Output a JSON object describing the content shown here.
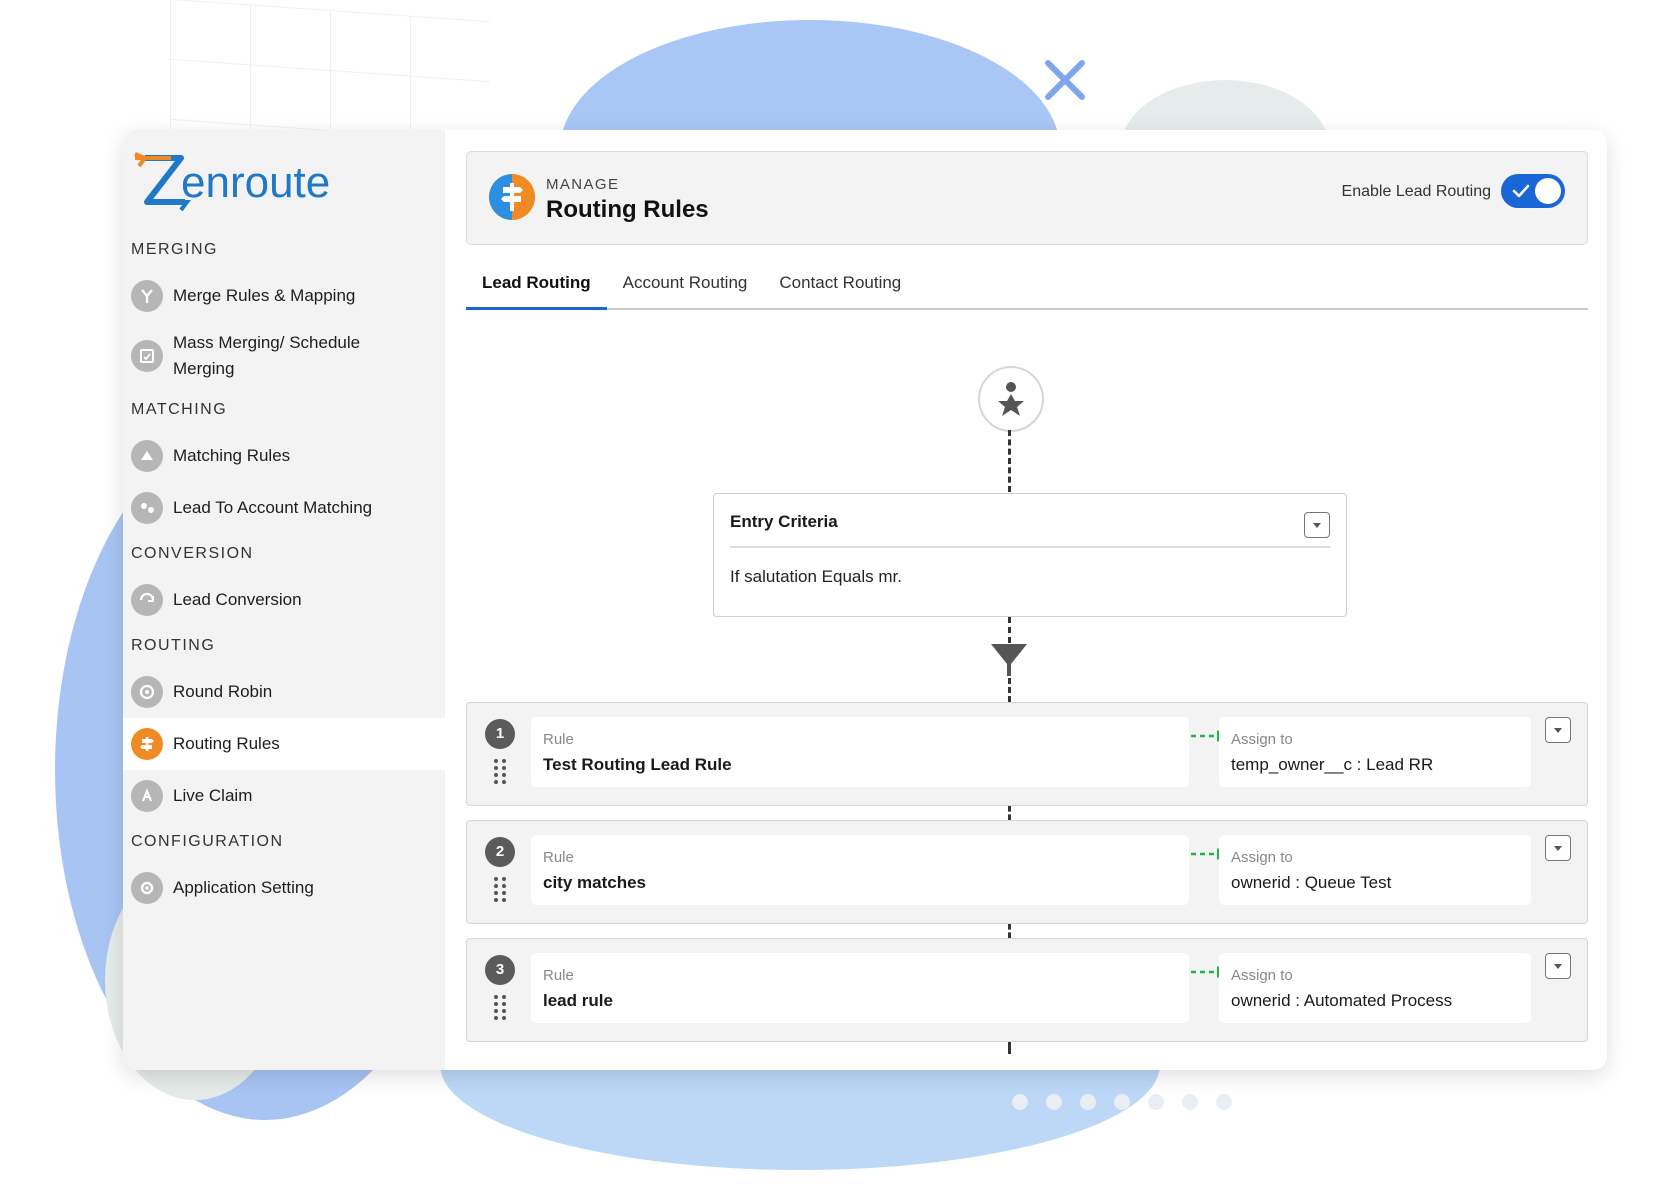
{
  "brand": {
    "name": "Zenroute"
  },
  "sidebar": {
    "sections": [
      {
        "title": "MERGING",
        "items": [
          {
            "label": "Merge Rules & Mapping",
            "icon": "merge-icon"
          },
          {
            "label": "Mass Merging/ Schedule Merging",
            "icon": "schedule-icon"
          }
        ]
      },
      {
        "title": "MATCHING",
        "items": [
          {
            "label": "Matching Rules",
            "icon": "matching-icon"
          },
          {
            "label": "Lead To Account Matching",
            "icon": "lead-account-icon"
          }
        ]
      },
      {
        "title": "CONVERSION",
        "items": [
          {
            "label": "Lead Conversion",
            "icon": "conversion-icon"
          }
        ]
      },
      {
        "title": "ROUTING",
        "items": [
          {
            "label": "Round Robin",
            "icon": "round-robin-icon"
          },
          {
            "label": "Routing Rules",
            "icon": "signpost-icon",
            "active": true
          },
          {
            "label": "Live Claim",
            "icon": "live-claim-icon"
          }
        ]
      },
      {
        "title": "CONFIGURATION",
        "items": [
          {
            "label": "Application Setting",
            "icon": "gear-icon"
          }
        ]
      }
    ]
  },
  "header": {
    "eyebrow": "MANAGE",
    "title": "Routing Rules",
    "toggle_label": "Enable Lead Routing",
    "toggle_on": true
  },
  "tabs": [
    {
      "label": "Lead Routing",
      "active": true
    },
    {
      "label": "Account Routing"
    },
    {
      "label": "Contact Routing"
    }
  ],
  "entry_criteria": {
    "title": "Entry Criteria",
    "condition": "If salutation Equals mr."
  },
  "rules": [
    {
      "number": "1",
      "rule_label": "Rule",
      "rule_name": "Test Routing Lead Rule",
      "assign_label": "Assign to",
      "assign_value": "temp_owner__c : Lead RR"
    },
    {
      "number": "2",
      "rule_label": "Rule",
      "rule_name": "city matches",
      "assign_label": "Assign to",
      "assign_value": "ownerid : Queue Test"
    },
    {
      "number": "3",
      "rule_label": "Rule",
      "rule_name": "lead rule",
      "assign_label": "Assign to",
      "assign_value": "ownerid : Automated Process"
    }
  ],
  "colors": {
    "accent": "#1b66d6",
    "brand_orange": "#f08a24",
    "connector_green": "#22b14c"
  }
}
